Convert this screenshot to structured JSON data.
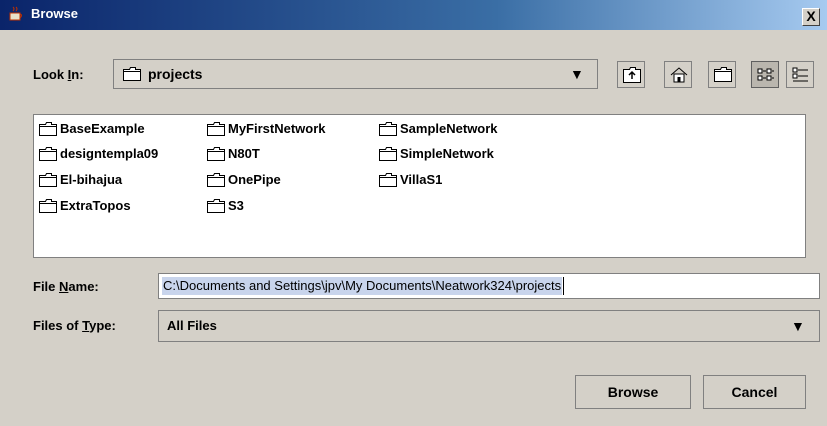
{
  "window": {
    "title": "Browse",
    "close_label": "X"
  },
  "look_in": {
    "label_pre": "Look ",
    "label_mnemonic": "I",
    "label_post": "n:",
    "value": "projects"
  },
  "toolbar": {
    "buttons": [
      {
        "name": "up-one-level-button",
        "icon": "up-folder-icon"
      },
      {
        "name": "home-button",
        "icon": "home-icon"
      },
      {
        "name": "new-folder-button",
        "icon": "new-folder-icon"
      },
      {
        "name": "list-view-button",
        "icon": "list-view-icon",
        "pressed": true
      },
      {
        "name": "details-view-button",
        "icon": "details-view-icon"
      }
    ]
  },
  "files": {
    "column1": [
      "BaseExample",
      "designtempla09",
      "El-bihajua",
      "ExtraTopos"
    ],
    "column2": [
      "MyFirstNetwork",
      "N80T",
      "OnePipe",
      "S3"
    ],
    "column3": [
      "SampleNetwork",
      "SimpleNetwork",
      "VillaS1"
    ]
  },
  "file_name": {
    "label_pre": "File ",
    "label_mnemonic": "N",
    "label_post": "ame:",
    "value": "C:\\Documents and Settings\\jpv\\My Documents\\Neatwork324\\projects"
  },
  "file_type": {
    "label_pre": "Files of ",
    "label_mnemonic": "T",
    "label_post": "ype:",
    "value": "All Files"
  },
  "buttons": {
    "browse": "Browse",
    "cancel": "Cancel"
  },
  "colors": {
    "titlebar_start": "#0a246a",
    "titlebar_end": "#a6caf0",
    "dialog_bg": "#d4d0c8",
    "selection": "#c8d4ec"
  }
}
